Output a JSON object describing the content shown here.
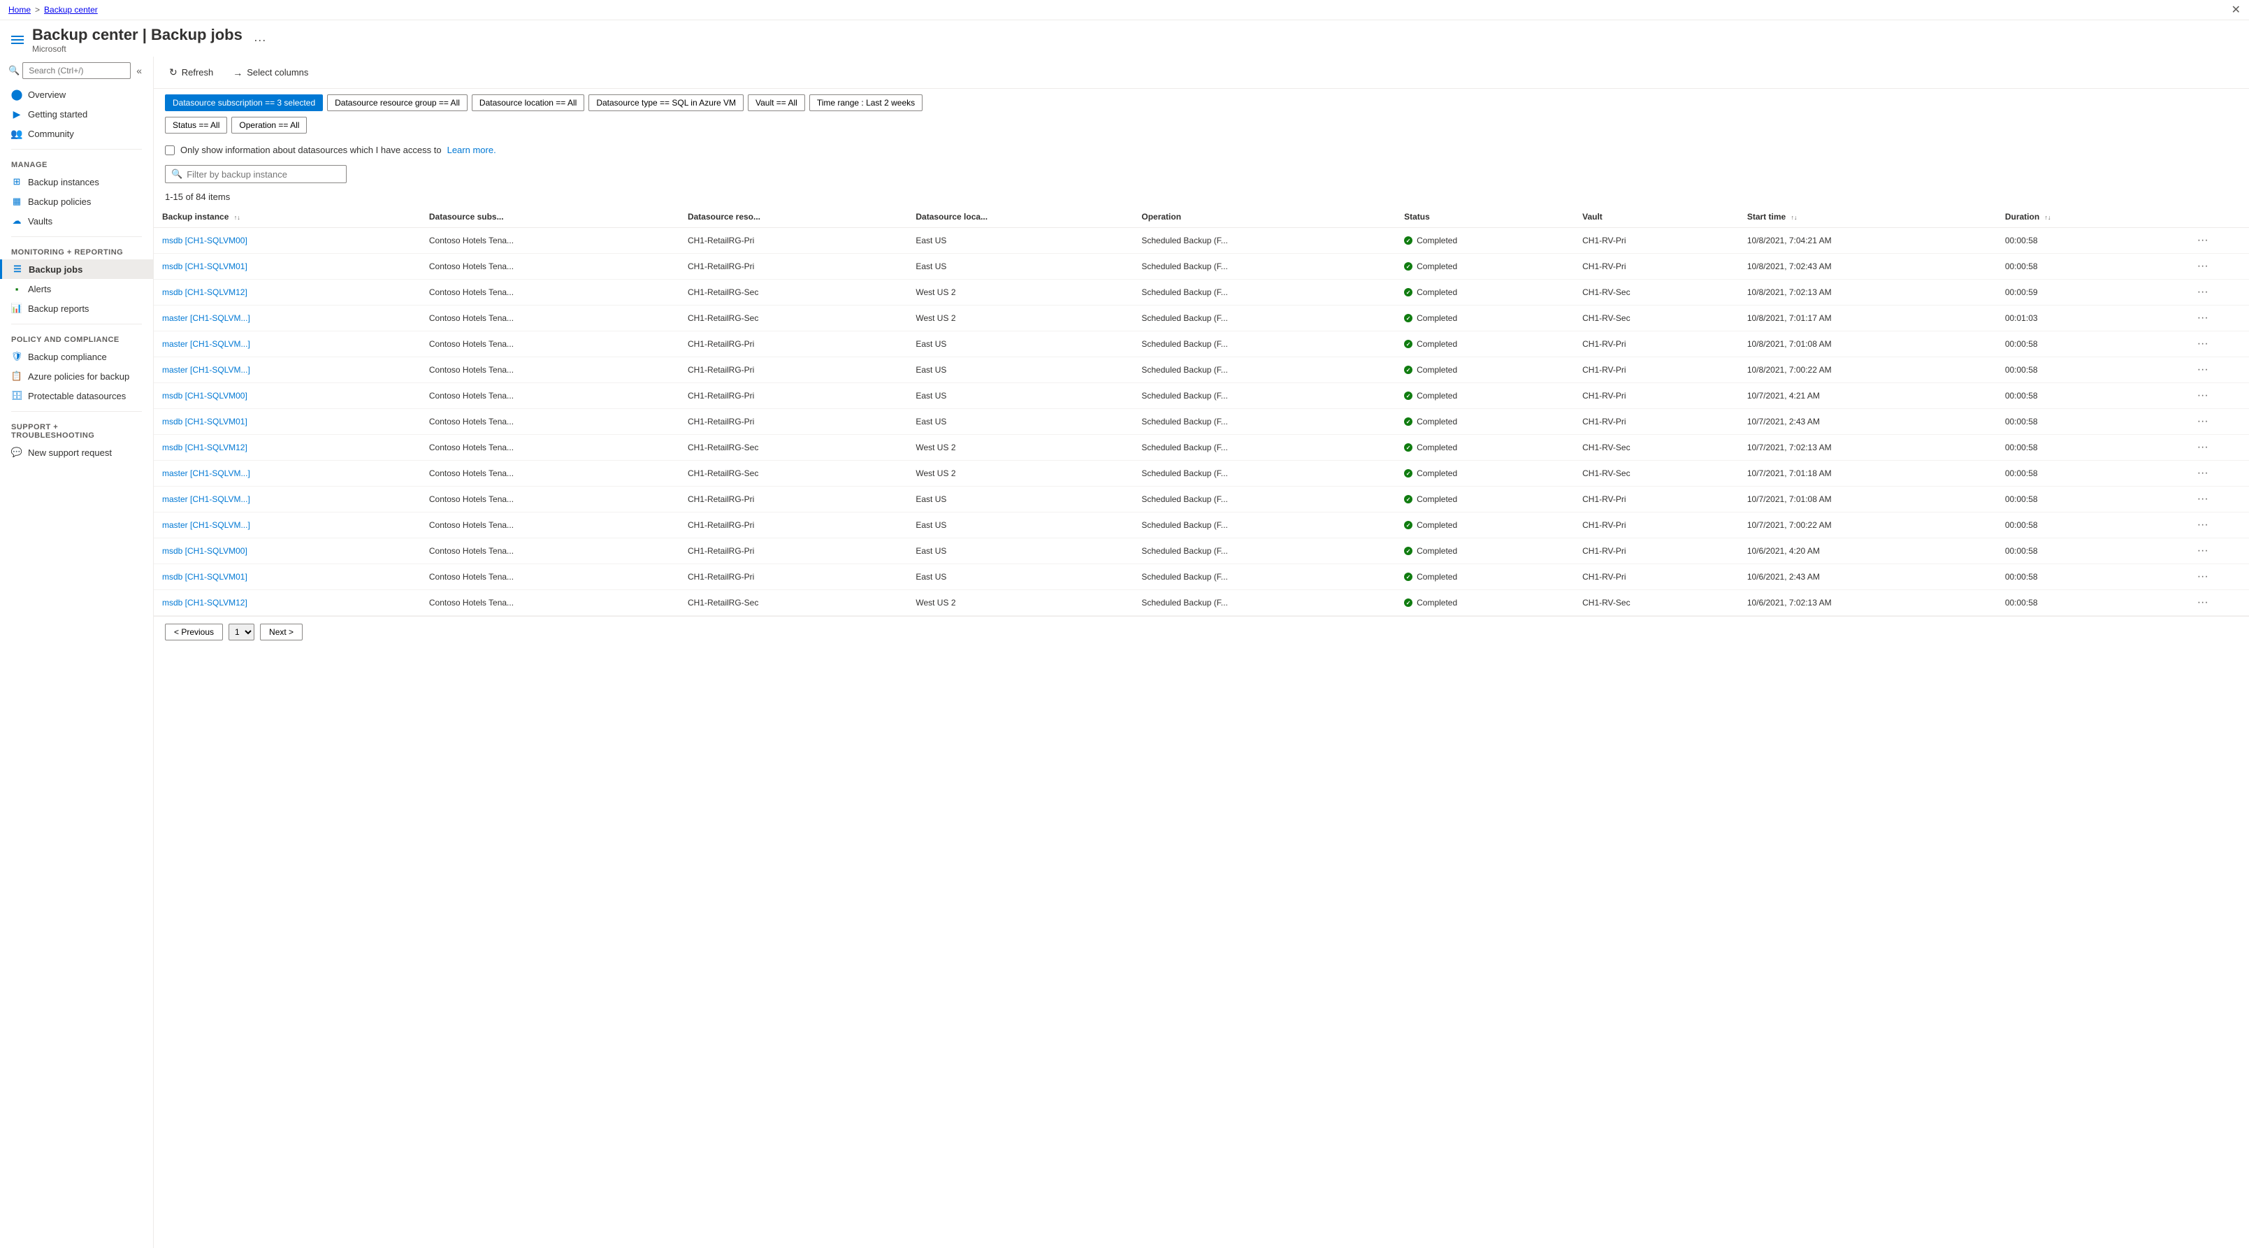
{
  "breadcrumb": {
    "home": "Home",
    "section": "Backup center",
    "separator": ">"
  },
  "header": {
    "title": "Backup center | Backup jobs",
    "subtitle": "Microsoft",
    "more_label": "···"
  },
  "sidebar": {
    "search_placeholder": "Search (Ctrl+/)",
    "collapse_tooltip": "Collapse",
    "items": [
      {
        "id": "overview",
        "label": "Overview",
        "icon": "circle-blue"
      },
      {
        "id": "getting-started",
        "label": "Getting started",
        "icon": "circle-blue"
      },
      {
        "id": "community",
        "label": "Community",
        "icon": "circle-blue"
      }
    ],
    "manage_title": "Manage",
    "manage_items": [
      {
        "id": "backup-instances",
        "label": "Backup instances",
        "icon": "grid-icon"
      },
      {
        "id": "backup-policies",
        "label": "Backup policies",
        "icon": "grid-icon"
      },
      {
        "id": "vaults",
        "label": "Vaults",
        "icon": "cloud-icon"
      }
    ],
    "monitoring_title": "Monitoring + reporting",
    "monitoring_items": [
      {
        "id": "backup-jobs",
        "label": "Backup jobs",
        "icon": "list-icon",
        "active": true
      },
      {
        "id": "alerts",
        "label": "Alerts",
        "icon": "alert-icon"
      },
      {
        "id": "backup-reports",
        "label": "Backup reports",
        "icon": "chart-icon"
      }
    ],
    "policy_title": "Policy and compliance",
    "policy_items": [
      {
        "id": "backup-compliance",
        "label": "Backup compliance",
        "icon": "compliance-icon"
      },
      {
        "id": "azure-policies",
        "label": "Azure policies for backup",
        "icon": "policy-icon"
      },
      {
        "id": "protectable-datasources",
        "label": "Protectable datasources",
        "icon": "datasource-icon"
      }
    ],
    "support_title": "Support + troubleshooting",
    "support_items": [
      {
        "id": "new-support-request",
        "label": "New support request",
        "icon": "support-icon"
      }
    ]
  },
  "toolbar": {
    "refresh_label": "Refresh",
    "select_columns_label": "Select columns"
  },
  "filters": [
    {
      "id": "datasource-subscription",
      "label": "Datasource subscription == 3 selected",
      "active": true
    },
    {
      "id": "datasource-resource-group",
      "label": "Datasource resource group == All",
      "active": false
    },
    {
      "id": "datasource-location",
      "label": "Datasource location == All",
      "active": false
    },
    {
      "id": "datasource-type",
      "label": "Datasource type == SQL in Azure VM",
      "active": false
    },
    {
      "id": "vault",
      "label": "Vault == All",
      "active": false
    },
    {
      "id": "time-range",
      "label": "Time range : Last 2 weeks",
      "active": false
    },
    {
      "id": "status",
      "label": "Status == All",
      "active": false
    },
    {
      "id": "operation",
      "label": "Operation == All",
      "active": false
    }
  ],
  "checkbox_label": "Only show information about datasources which I have access to",
  "learn_more_label": "Learn more.",
  "search_placeholder": "Filter by backup instance",
  "items_count": "1-15 of 84 items",
  "columns": [
    {
      "id": "backup-instance",
      "label": "Backup instance",
      "sortable": true
    },
    {
      "id": "datasource-subs",
      "label": "Datasource subs...",
      "sortable": false
    },
    {
      "id": "datasource-reso",
      "label": "Datasource reso...",
      "sortable": false
    },
    {
      "id": "datasource-loca",
      "label": "Datasource loca...",
      "sortable": false
    },
    {
      "id": "operation",
      "label": "Operation",
      "sortable": false
    },
    {
      "id": "status",
      "label": "Status",
      "sortable": false
    },
    {
      "id": "vault",
      "label": "Vault",
      "sortable": false
    },
    {
      "id": "start-time",
      "label": "Start time",
      "sortable": true
    },
    {
      "id": "duration",
      "label": "Duration",
      "sortable": true
    }
  ],
  "rows": [
    {
      "instance": "msdb [CH1-SQLVM00]",
      "subs": "Contoso Hotels Tena...",
      "reso": "CH1-RetailRG-Pri",
      "loca": "East US",
      "operation": "Scheduled Backup (F...",
      "status": "Completed",
      "vault": "CH1-RV-Pri",
      "start": "10/8/2021, 7:04:21 AM",
      "duration": "00:00:58"
    },
    {
      "instance": "msdb [CH1-SQLVM01]",
      "subs": "Contoso Hotels Tena...",
      "reso": "CH1-RetailRG-Pri",
      "loca": "East US",
      "operation": "Scheduled Backup (F...",
      "status": "Completed",
      "vault": "CH1-RV-Pri",
      "start": "10/8/2021, 7:02:43 AM",
      "duration": "00:00:58"
    },
    {
      "instance": "msdb [CH1-SQLVM12]",
      "subs": "Contoso Hotels Tena...",
      "reso": "CH1-RetailRG-Sec",
      "loca": "West US 2",
      "operation": "Scheduled Backup (F...",
      "status": "Completed",
      "vault": "CH1-RV-Sec",
      "start": "10/8/2021, 7:02:13 AM",
      "duration": "00:00:59"
    },
    {
      "instance": "master [CH1-SQLVM...]",
      "subs": "Contoso Hotels Tena...",
      "reso": "CH1-RetailRG-Sec",
      "loca": "West US 2",
      "operation": "Scheduled Backup (F...",
      "status": "Completed",
      "vault": "CH1-RV-Sec",
      "start": "10/8/2021, 7:01:17 AM",
      "duration": "00:01:03"
    },
    {
      "instance": "master [CH1-SQLVM...]",
      "subs": "Contoso Hotels Tena...",
      "reso": "CH1-RetailRG-Pri",
      "loca": "East US",
      "operation": "Scheduled Backup (F...",
      "status": "Completed",
      "vault": "CH1-RV-Pri",
      "start": "10/8/2021, 7:01:08 AM",
      "duration": "00:00:58"
    },
    {
      "instance": "master [CH1-SQLVM...]",
      "subs": "Contoso Hotels Tena...",
      "reso": "CH1-RetailRG-Pri",
      "loca": "East US",
      "operation": "Scheduled Backup (F...",
      "status": "Completed",
      "vault": "CH1-RV-Pri",
      "start": "10/8/2021, 7:00:22 AM",
      "duration": "00:00:58"
    },
    {
      "instance": "msdb [CH1-SQLVM00]",
      "subs": "Contoso Hotels Tena...",
      "reso": "CH1-RetailRG-Pri",
      "loca": "East US",
      "operation": "Scheduled Backup (F...",
      "status": "Completed",
      "vault": "CH1-RV-Pri",
      "start": "10/7/2021, 4:21 AM",
      "duration": "00:00:58"
    },
    {
      "instance": "msdb [CH1-SQLVM01]",
      "subs": "Contoso Hotels Tena...",
      "reso": "CH1-RetailRG-Pri",
      "loca": "East US",
      "operation": "Scheduled Backup (F...",
      "status": "Completed",
      "vault": "CH1-RV-Pri",
      "start": "10/7/2021, 2:43 AM",
      "duration": "00:00:58"
    },
    {
      "instance": "msdb [CH1-SQLVM12]",
      "subs": "Contoso Hotels Tena...",
      "reso": "CH1-RetailRG-Sec",
      "loca": "West US 2",
      "operation": "Scheduled Backup (F...",
      "status": "Completed",
      "vault": "CH1-RV-Sec",
      "start": "10/7/2021, 7:02:13 AM",
      "duration": "00:00:58"
    },
    {
      "instance": "master [CH1-SQLVM...]",
      "subs": "Contoso Hotels Tena...",
      "reso": "CH1-RetailRG-Sec",
      "loca": "West US 2",
      "operation": "Scheduled Backup (F...",
      "status": "Completed",
      "vault": "CH1-RV-Sec",
      "start": "10/7/2021, 7:01:18 AM",
      "duration": "00:00:58"
    },
    {
      "instance": "master [CH1-SQLVM...]",
      "subs": "Contoso Hotels Tena...",
      "reso": "CH1-RetailRG-Pri",
      "loca": "East US",
      "operation": "Scheduled Backup (F...",
      "status": "Completed",
      "vault": "CH1-RV-Pri",
      "start": "10/7/2021, 7:01:08 AM",
      "duration": "00:00:58"
    },
    {
      "instance": "master [CH1-SQLVM...]",
      "subs": "Contoso Hotels Tena...",
      "reso": "CH1-RetailRG-Pri",
      "loca": "East US",
      "operation": "Scheduled Backup (F...",
      "status": "Completed",
      "vault": "CH1-RV-Pri",
      "start": "10/7/2021, 7:00:22 AM",
      "duration": "00:00:58"
    },
    {
      "instance": "msdb [CH1-SQLVM00]",
      "subs": "Contoso Hotels Tena...",
      "reso": "CH1-RetailRG-Pri",
      "loca": "East US",
      "operation": "Scheduled Backup (F...",
      "status": "Completed",
      "vault": "CH1-RV-Pri",
      "start": "10/6/2021, 4:20 AM",
      "duration": "00:00:58"
    },
    {
      "instance": "msdb [CH1-SQLVM01]",
      "subs": "Contoso Hotels Tena...",
      "reso": "CH1-RetailRG-Pri",
      "loca": "East US",
      "operation": "Scheduled Backup (F...",
      "status": "Completed",
      "vault": "CH1-RV-Pri",
      "start": "10/6/2021, 2:43 AM",
      "duration": "00:00:58"
    },
    {
      "instance": "msdb [CH1-SQLVM12]",
      "subs": "Contoso Hotels Tena...",
      "reso": "CH1-RetailRG-Sec",
      "loca": "West US 2",
      "operation": "Scheduled Backup (F...",
      "status": "Completed",
      "vault": "CH1-RV-Sec",
      "start": "10/6/2021, 7:02:13 AM",
      "duration": "00:00:58"
    }
  ],
  "pagination": {
    "previous_label": "< Previous",
    "next_label": "Next >",
    "page_number": "1"
  }
}
